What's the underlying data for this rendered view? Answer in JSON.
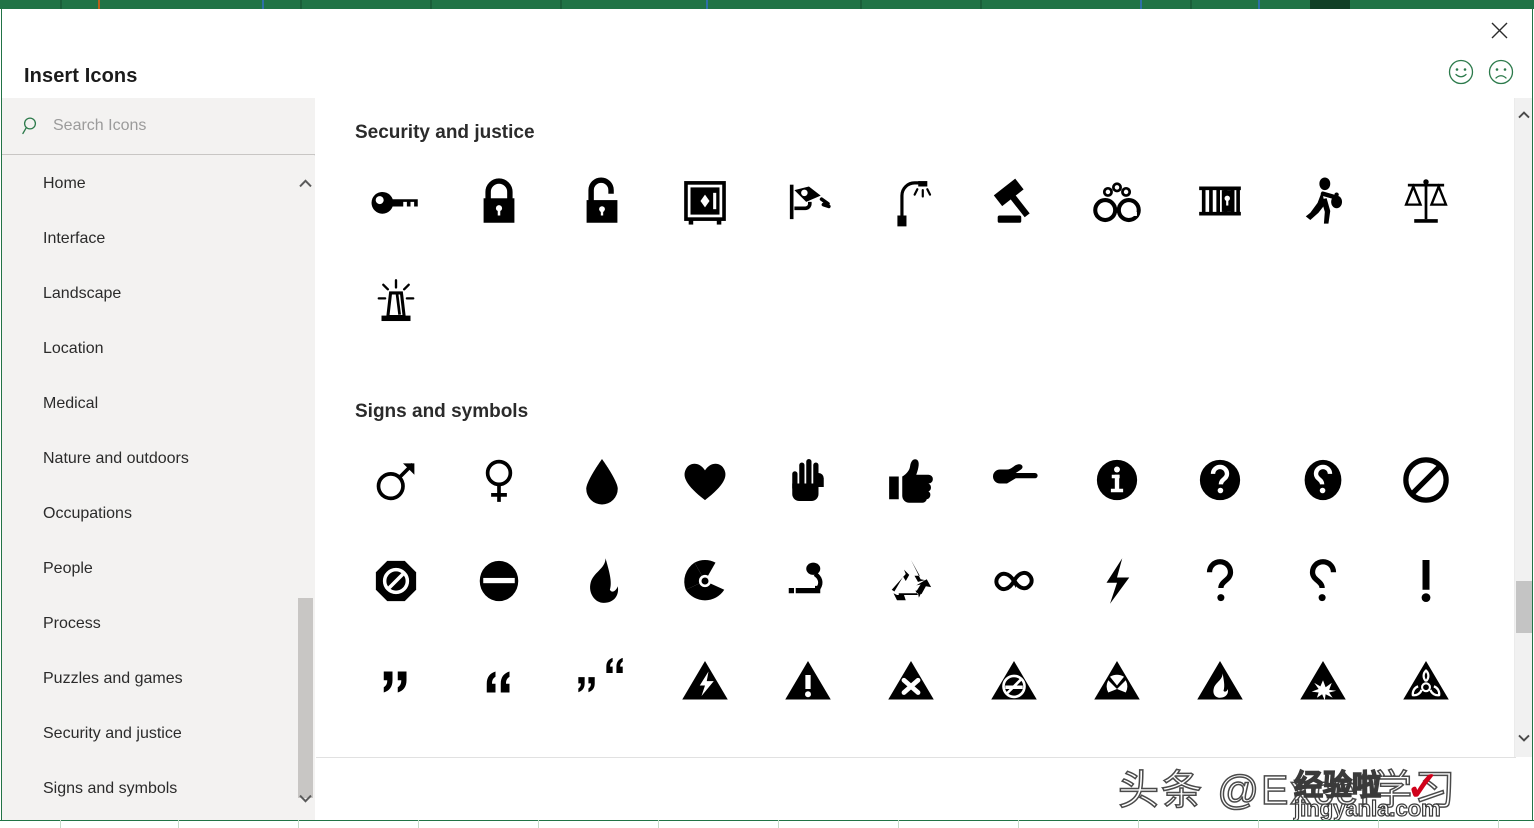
{
  "window": {
    "title": "Insert Icons",
    "close_label": "×",
    "feedback_happy": "smiley-face",
    "feedback_sad": "frowny-face"
  },
  "search": {
    "placeholder": "Search Icons",
    "value": "",
    "icon": "search-icon"
  },
  "sidebar": {
    "items": [
      {
        "label": "Home"
      },
      {
        "label": "Interface"
      },
      {
        "label": "Landscape"
      },
      {
        "label": "Location"
      },
      {
        "label": "Medical"
      },
      {
        "label": "Nature and outdoors"
      },
      {
        "label": "Occupations"
      },
      {
        "label": "People"
      },
      {
        "label": "Process"
      },
      {
        "label": "Puzzles and games"
      },
      {
        "label": "Security and justice"
      },
      {
        "label": "Signs and symbols"
      }
    ],
    "scroll_up_icon": "chevron-up-icon",
    "scroll_down_icon": "chevron-down-icon"
  },
  "gallery": {
    "sections": [
      {
        "title": "Security and justice",
        "icons": [
          "key-icon",
          "padlock-closed-icon",
          "padlock-open-icon",
          "safe-icon",
          "security-camera-icon",
          "street-lamp-icon",
          "gavel-icon",
          "handcuffs-icon",
          "jail-bars-icon",
          "running-thief-icon",
          "scales-of-justice-icon",
          "siren-light-icon"
        ]
      },
      {
        "title": "Signs and symbols",
        "icons": [
          "male-symbol-icon",
          "female-symbol-icon",
          "water-drop-icon",
          "heart-icon",
          "open-hand-icon",
          "thumbs-up-icon",
          "pointing-hand-icon",
          "info-circle-icon",
          "question-circle-icon",
          "inverted-question-circle-icon",
          "prohibition-icon",
          "stop-sign-icon",
          "minus-circle-icon",
          "flame-icon",
          "radiation-icon",
          "smoking-icon",
          "recycle-icon",
          "infinity-icon",
          "lightning-bolt-icon",
          "question-mark-icon",
          "inverted-question-mark-icon",
          "exclamation-mark-icon",
          "open-quote-icon",
          "close-quote-icon",
          "quote-pair-icon",
          "electrical-hazard-triangle-icon",
          "warning-triangle-icon",
          "error-x-triangle-icon",
          "no-smoking-triangle-icon",
          "radiation-triangle-icon",
          "flammable-triangle-icon",
          "explosion-triangle-icon",
          "biohazard-triangle-icon"
        ]
      }
    ]
  },
  "scrollbar": {
    "up_icon": "chevron-up-icon",
    "down_icon": "chevron-down-icon"
  },
  "watermark": {
    "main": "头条 @Excel学习",
    "sub": "经验啦",
    "url": "jingyanla.com",
    "check": "✓"
  },
  "colors": {
    "accent_green": "#217346",
    "sidebar_bg": "#f3f2f1",
    "text": "#2b2b2b",
    "watermark_red": "#d0021b"
  }
}
